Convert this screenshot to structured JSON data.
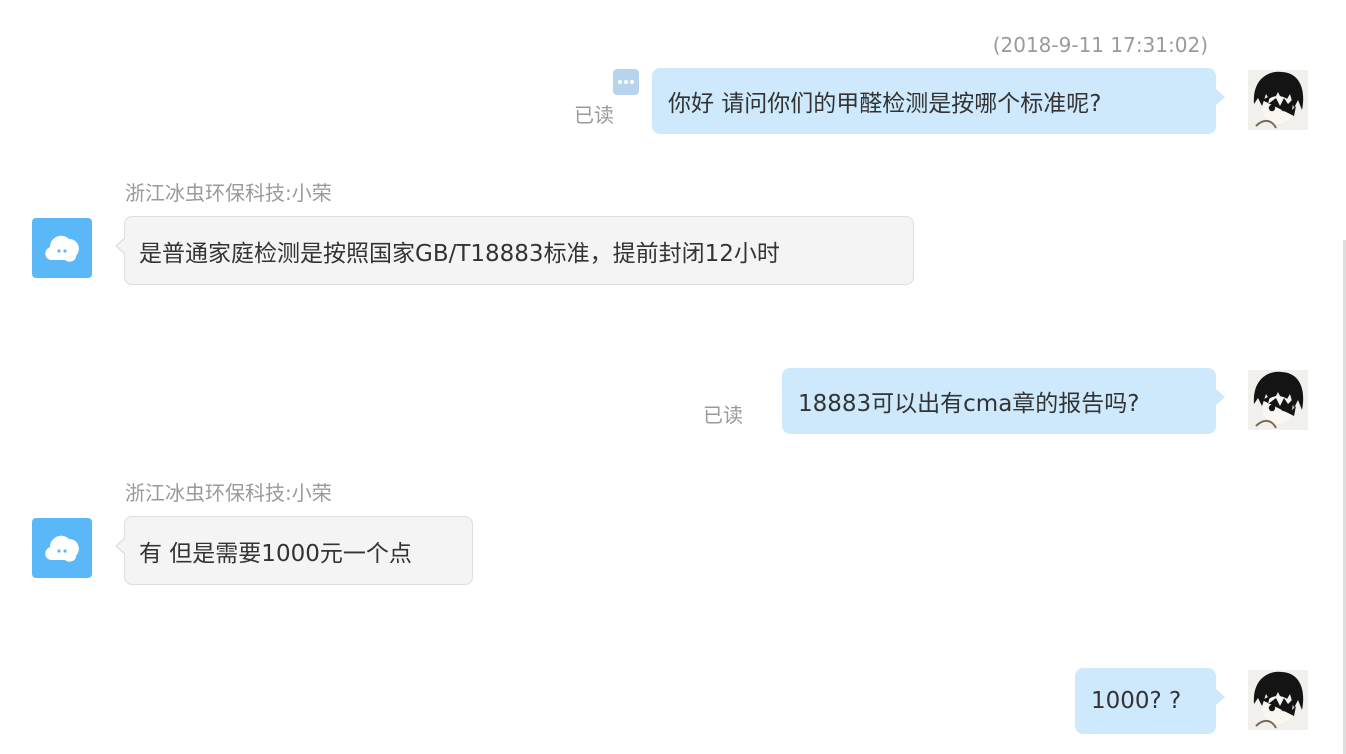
{
  "chat": {
    "timestamp": "(2018-9-11 17:31:02)",
    "messages": [
      {
        "direction": "outgoing",
        "text": "你好 请问你们的甲醛检测是按哪个标准呢?",
        "status": "已读"
      },
      {
        "direction": "incoming",
        "sender": "浙江冰虫环保科技:小荣",
        "text": "是普通家庭检测是按照国家GB/T18883标准，提前封闭12小时"
      },
      {
        "direction": "outgoing",
        "text": "18883可以出有cma章的报告吗?",
        "status": "已读"
      },
      {
        "direction": "incoming",
        "sender": "浙江冰虫环保科技:小荣",
        "text": "有 但是需要1000元一个点"
      },
      {
        "direction": "outgoing",
        "text": "1000? ?"
      }
    ]
  },
  "icons": {
    "more": "more-icon",
    "user_avatar": "user-avatar-icon",
    "bot_avatar": "bot-avatar-icon"
  },
  "colors": {
    "outgoing_bubble": "#cde9fb",
    "incoming_bubble": "#f4f4f4",
    "bot_avatar": "#5bb8f8",
    "muted_text": "#9a9a9a"
  }
}
